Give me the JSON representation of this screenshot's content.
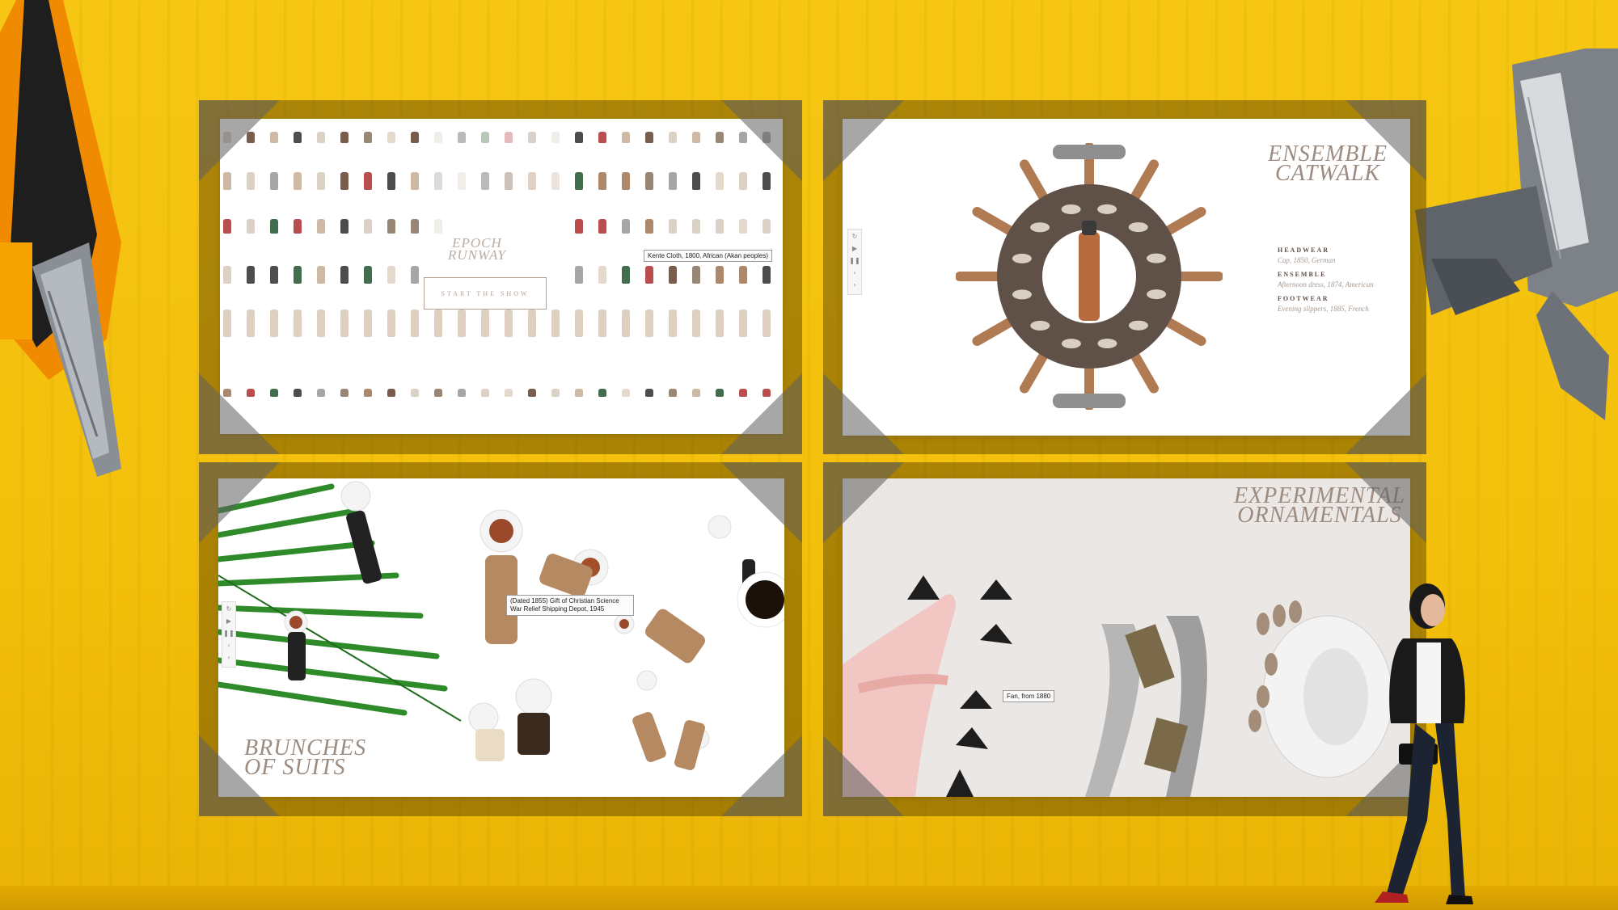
{
  "colors": {
    "wall": "#f4c20e",
    "title": "#9c8b80",
    "ring": "#5f5148",
    "panel": "#ffffff"
  },
  "panels": {
    "epoch": {
      "title_line1": "EPOCH",
      "title_line2": "RUNWAY",
      "start_button": "START THE SHOW",
      "tooltip": "Kente Cloth, 1800, African (Akan peoples)"
    },
    "catwalk": {
      "title_line1": "ENSEMBLE",
      "title_line2": "CATWALK",
      "details": [
        {
          "heading": "HEADWEAR",
          "value": "Cap, 1850, German"
        },
        {
          "heading": "ENSEMBLE",
          "value": "Afternoon dress, 1874, American"
        },
        {
          "heading": "FOOTWEAR",
          "value": "Evening slippers, 1885, French"
        }
      ]
    },
    "brunches": {
      "title_line1": "BRUNCHES",
      "title_line2": "OF SUITS",
      "tooltip": "(Dated 1855) Gift of Christian Science War Relief Shipping Depot, 1945"
    },
    "ornamentals": {
      "title_line1": "EXPERIMENTAL",
      "title_line2": "ORNAMENTALS",
      "tooltip": "Fan, from 1880"
    }
  },
  "controls": [
    "refresh-icon",
    "play-icon",
    "pause-icon",
    "prev-icon",
    "next-icon"
  ]
}
